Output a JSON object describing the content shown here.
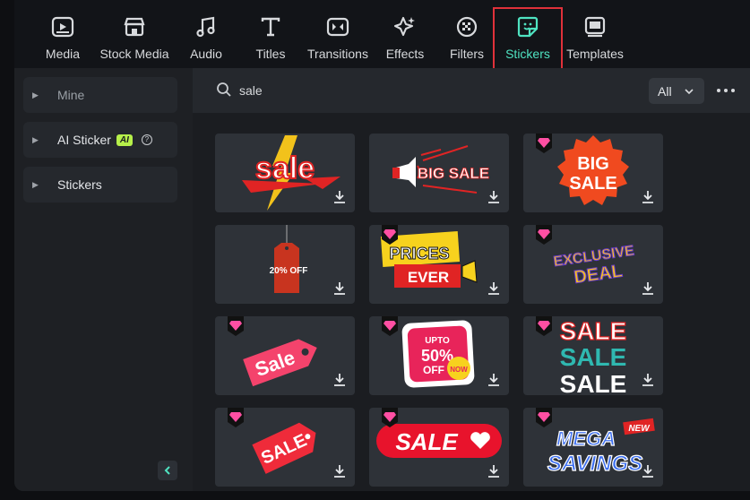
{
  "toolbar": {
    "items": [
      {
        "label": "Media",
        "icon": "media-icon"
      },
      {
        "label": "Stock Media",
        "icon": "stock-media-icon"
      },
      {
        "label": "Audio",
        "icon": "music-note-icon"
      },
      {
        "label": "Titles",
        "icon": "text-t-icon"
      },
      {
        "label": "Transitions",
        "icon": "transition-icon"
      },
      {
        "label": "Effects",
        "icon": "sparkle-icon"
      },
      {
        "label": "Filters",
        "icon": "filter-icon"
      },
      {
        "label": "Stickers",
        "icon": "sticker-icon",
        "active": true
      },
      {
        "label": "Templates",
        "icon": "template-icon"
      }
    ],
    "active_color": "#4fe3c1",
    "highlight_color": "#e0313a"
  },
  "sidebar": {
    "items": [
      {
        "label": "Mine"
      },
      {
        "label": "AI Sticker",
        "badge": "AI"
      },
      {
        "label": "Stickers"
      }
    ]
  },
  "search": {
    "query": "sale",
    "filter_value": "All"
  },
  "stickers": [
    {
      "name": "sale-lightning",
      "text": "sale",
      "premium": false
    },
    {
      "name": "big-sale-megaphone",
      "text": "BIG SALE",
      "premium": false
    },
    {
      "name": "big-sale-badge",
      "text": "BIG SALE",
      "premium": true
    },
    {
      "name": "sale-tag",
      "text": "20% OFF",
      "premium": false
    },
    {
      "name": "lowest-prices-ever",
      "text": "PRICES EVER",
      "premium": true
    },
    {
      "name": "exclusive-deal",
      "text": "EXCLUSIVE DEAL",
      "premium": true
    },
    {
      "name": "sale-pink-tag",
      "text": "Sale",
      "premium": true
    },
    {
      "name": "upto-50-off",
      "text": "UPTO 50% OFF",
      "premium": true
    },
    {
      "name": "sale-sale-sale",
      "text": "SALE SALE SALE",
      "premium": true
    },
    {
      "name": "sale-red-tag",
      "text": "SALE",
      "premium": true
    },
    {
      "name": "sale-heart-banner",
      "text": "SALE",
      "premium": true
    },
    {
      "name": "mega-savings",
      "text": "MEGA SAVINGS",
      "premium": true
    }
  ]
}
